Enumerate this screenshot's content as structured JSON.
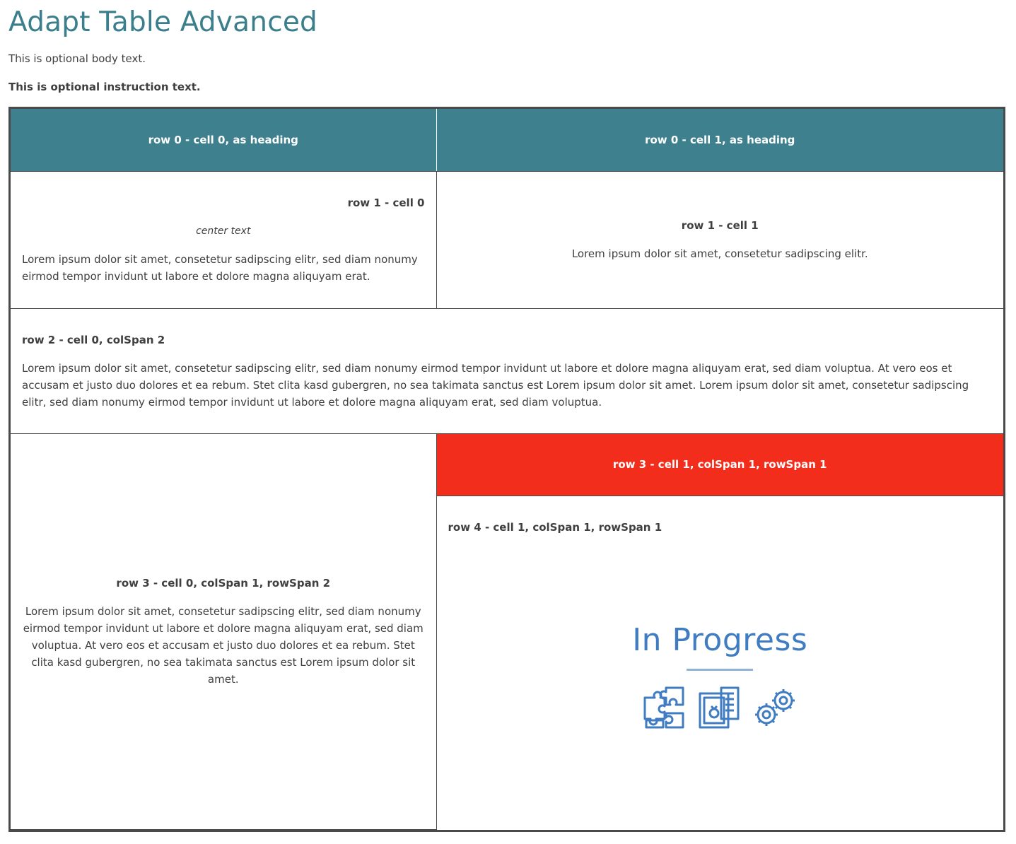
{
  "page": {
    "title": "Adapt Table Advanced",
    "body": "This is optional body text.",
    "instruction": "This is optional instruction text."
  },
  "table": {
    "header": [
      "row 0 - cell 0, as heading",
      "row 0 - cell 1, as heading"
    ],
    "row1": {
      "cell0": {
        "title": "row 1 - cell 0",
        "center": "center text",
        "text": "Lorem ipsum dolor sit amet, consetetur sadipscing elitr, sed diam nonumy eirmod tempor invidunt ut labore et dolore magna aliquyam erat."
      },
      "cell1": {
        "title": "row 1 - cell 1",
        "text": "Lorem ipsum dolor sit amet, consetetur sadipscing elitr."
      }
    },
    "row2": {
      "cell0": {
        "title": "row 2 - cell 0, colSpan 2",
        "text": "Lorem ipsum dolor sit amet, consetetur sadipscing elitr, sed diam nonumy eirmod tempor invidunt ut labore et dolore magna aliquyam erat, sed diam voluptua. At vero eos et accusam et justo duo dolores et ea rebum. Stet clita kasd gubergren, no sea takimata sanctus est Lorem ipsum dolor sit amet. Lorem ipsum dolor sit amet, consetetur sadipscing elitr, sed diam nonumy eirmod tempor invidunt ut labore et dolore magna aliquyam erat, sed diam voluptua."
      }
    },
    "row3": {
      "cell0": {
        "title": "row 3 - cell 0, colSpan 1, rowSpan 2",
        "text": "Lorem ipsum dolor sit amet, consetetur sadipscing elitr, sed diam nonumy eirmod tempor invidunt ut labore et dolore magna aliquyam erat, sed diam voluptua. At vero eos et accusam et justo duo dolores et ea rebum. Stet clita kasd gubergren, no sea takimata sanctus est Lorem ipsum dolor sit amet."
      },
      "cell1": {
        "title": "row 3 - cell 1, colSpan 1, rowSpan 1"
      }
    },
    "row4": {
      "cell1": {
        "title": "row 4 - cell 1, colSpan 1, rowSpan 1",
        "image_text": "In Progress",
        "icons": [
          "puzzle-icon",
          "document-stamp-icon",
          "gears-icon"
        ]
      }
    }
  },
  "colors": {
    "title": "#3b7f8c",
    "header_bg": "#3e808e",
    "highlight_bg": "#f22d1b",
    "progress_blue": "#3f7cc1"
  }
}
